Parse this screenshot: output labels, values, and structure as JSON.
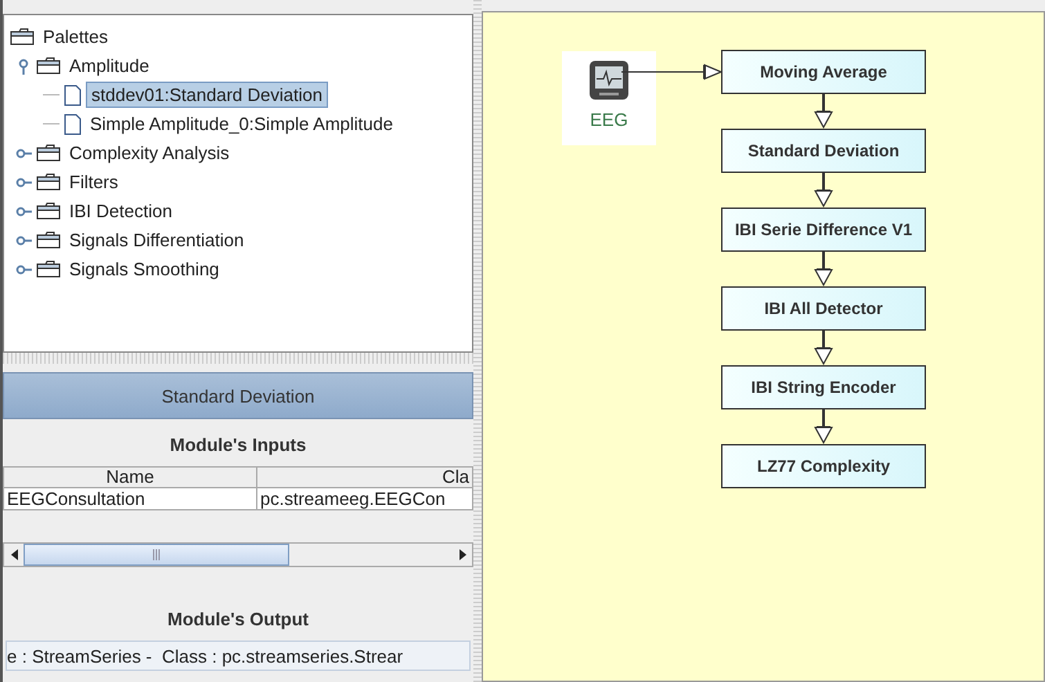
{
  "palette_tree": {
    "label": "Palettes",
    "children": [
      {
        "label": "Amplitude",
        "expanded": true,
        "selected": false,
        "children": [
          {
            "label": "stddev01:Standard Deviation",
            "selected": true
          },
          {
            "label": "Simple Amplitude_0:Simple Amplitude",
            "selected": false
          }
        ]
      },
      {
        "label": "Complexity Analysis",
        "expanded": false,
        "selected": false
      },
      {
        "label": "Filters",
        "expanded": false,
        "selected": false
      },
      {
        "label": "IBI Detection",
        "expanded": false,
        "selected": false
      },
      {
        "label": "Signals Differentiation",
        "expanded": false,
        "selected": false
      },
      {
        "label": "Signals Smoothing",
        "expanded": false,
        "selected": false
      }
    ]
  },
  "module_panel": {
    "title": "Standard Deviation",
    "inputs_heading": "Module's Inputs",
    "inputs_table": {
      "columns": [
        "Name",
        "Cla"
      ],
      "rows": [
        [
          "EEGConsultation",
          "pc.streameeg.EEGCon"
        ]
      ]
    },
    "output_heading": "Module's Output",
    "output_value": "e : StreamSeries -  Class : pc.streamseries.Strear"
  },
  "canvas": {
    "source": {
      "label": "EEG"
    },
    "modules": [
      "Moving Average",
      "Standard Deviation",
      "IBI Serie Difference V1",
      "IBI All Detector",
      "IBI String Encoder",
      "LZ77 Complexity"
    ]
  }
}
